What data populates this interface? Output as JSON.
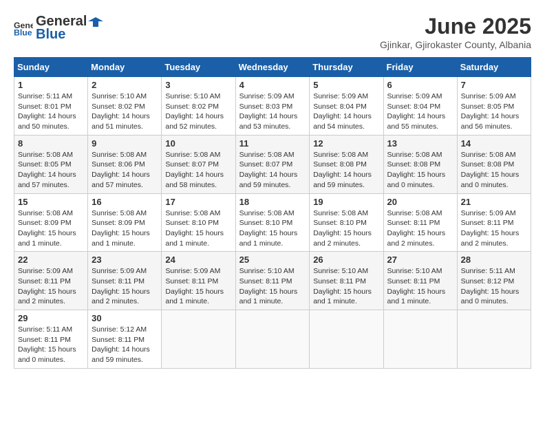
{
  "logo": {
    "general": "General",
    "blue": "Blue"
  },
  "title": "June 2025",
  "location": "Gjinkar, Gjirokaster County, Albania",
  "weekdays": [
    "Sunday",
    "Monday",
    "Tuesday",
    "Wednesday",
    "Thursday",
    "Friday",
    "Saturday"
  ],
  "weeks": [
    [
      {
        "day": "1",
        "sunrise": "Sunrise: 5:11 AM",
        "sunset": "Sunset: 8:01 PM",
        "daylight": "Daylight: 14 hours and 50 minutes."
      },
      {
        "day": "2",
        "sunrise": "Sunrise: 5:10 AM",
        "sunset": "Sunset: 8:02 PM",
        "daylight": "Daylight: 14 hours and 51 minutes."
      },
      {
        "day": "3",
        "sunrise": "Sunrise: 5:10 AM",
        "sunset": "Sunset: 8:02 PM",
        "daylight": "Daylight: 14 hours and 52 minutes."
      },
      {
        "day": "4",
        "sunrise": "Sunrise: 5:09 AM",
        "sunset": "Sunset: 8:03 PM",
        "daylight": "Daylight: 14 hours and 53 minutes."
      },
      {
        "day": "5",
        "sunrise": "Sunrise: 5:09 AM",
        "sunset": "Sunset: 8:04 PM",
        "daylight": "Daylight: 14 hours and 54 minutes."
      },
      {
        "day": "6",
        "sunrise": "Sunrise: 5:09 AM",
        "sunset": "Sunset: 8:04 PM",
        "daylight": "Daylight: 14 hours and 55 minutes."
      },
      {
        "day": "7",
        "sunrise": "Sunrise: 5:09 AM",
        "sunset": "Sunset: 8:05 PM",
        "daylight": "Daylight: 14 hours and 56 minutes."
      }
    ],
    [
      {
        "day": "8",
        "sunrise": "Sunrise: 5:08 AM",
        "sunset": "Sunset: 8:05 PM",
        "daylight": "Daylight: 14 hours and 57 minutes."
      },
      {
        "day": "9",
        "sunrise": "Sunrise: 5:08 AM",
        "sunset": "Sunset: 8:06 PM",
        "daylight": "Daylight: 14 hours and 57 minutes."
      },
      {
        "day": "10",
        "sunrise": "Sunrise: 5:08 AM",
        "sunset": "Sunset: 8:07 PM",
        "daylight": "Daylight: 14 hours and 58 minutes."
      },
      {
        "day": "11",
        "sunrise": "Sunrise: 5:08 AM",
        "sunset": "Sunset: 8:07 PM",
        "daylight": "Daylight: 14 hours and 59 minutes."
      },
      {
        "day": "12",
        "sunrise": "Sunrise: 5:08 AM",
        "sunset": "Sunset: 8:08 PM",
        "daylight": "Daylight: 14 hours and 59 minutes."
      },
      {
        "day": "13",
        "sunrise": "Sunrise: 5:08 AM",
        "sunset": "Sunset: 8:08 PM",
        "daylight": "Daylight: 15 hours and 0 minutes."
      },
      {
        "day": "14",
        "sunrise": "Sunrise: 5:08 AM",
        "sunset": "Sunset: 8:08 PM",
        "daylight": "Daylight: 15 hours and 0 minutes."
      }
    ],
    [
      {
        "day": "15",
        "sunrise": "Sunrise: 5:08 AM",
        "sunset": "Sunset: 8:09 PM",
        "daylight": "Daylight: 15 hours and 1 minute."
      },
      {
        "day": "16",
        "sunrise": "Sunrise: 5:08 AM",
        "sunset": "Sunset: 8:09 PM",
        "daylight": "Daylight: 15 hours and 1 minute."
      },
      {
        "day": "17",
        "sunrise": "Sunrise: 5:08 AM",
        "sunset": "Sunset: 8:10 PM",
        "daylight": "Daylight: 15 hours and 1 minute."
      },
      {
        "day": "18",
        "sunrise": "Sunrise: 5:08 AM",
        "sunset": "Sunset: 8:10 PM",
        "daylight": "Daylight: 15 hours and 1 minute."
      },
      {
        "day": "19",
        "sunrise": "Sunrise: 5:08 AM",
        "sunset": "Sunset: 8:10 PM",
        "daylight": "Daylight: 15 hours and 2 minutes."
      },
      {
        "day": "20",
        "sunrise": "Sunrise: 5:08 AM",
        "sunset": "Sunset: 8:11 PM",
        "daylight": "Daylight: 15 hours and 2 minutes."
      },
      {
        "day": "21",
        "sunrise": "Sunrise: 5:09 AM",
        "sunset": "Sunset: 8:11 PM",
        "daylight": "Daylight: 15 hours and 2 minutes."
      }
    ],
    [
      {
        "day": "22",
        "sunrise": "Sunrise: 5:09 AM",
        "sunset": "Sunset: 8:11 PM",
        "daylight": "Daylight: 15 hours and 2 minutes."
      },
      {
        "day": "23",
        "sunrise": "Sunrise: 5:09 AM",
        "sunset": "Sunset: 8:11 PM",
        "daylight": "Daylight: 15 hours and 2 minutes."
      },
      {
        "day": "24",
        "sunrise": "Sunrise: 5:09 AM",
        "sunset": "Sunset: 8:11 PM",
        "daylight": "Daylight: 15 hours and 1 minute."
      },
      {
        "day": "25",
        "sunrise": "Sunrise: 5:10 AM",
        "sunset": "Sunset: 8:11 PM",
        "daylight": "Daylight: 15 hours and 1 minute."
      },
      {
        "day": "26",
        "sunrise": "Sunrise: 5:10 AM",
        "sunset": "Sunset: 8:11 PM",
        "daylight": "Daylight: 15 hours and 1 minute."
      },
      {
        "day": "27",
        "sunrise": "Sunrise: 5:10 AM",
        "sunset": "Sunset: 8:11 PM",
        "daylight": "Daylight: 15 hours and 1 minute."
      },
      {
        "day": "28",
        "sunrise": "Sunrise: 5:11 AM",
        "sunset": "Sunset: 8:12 PM",
        "daylight": "Daylight: 15 hours and 0 minutes."
      }
    ],
    [
      {
        "day": "29",
        "sunrise": "Sunrise: 5:11 AM",
        "sunset": "Sunset: 8:11 PM",
        "daylight": "Daylight: 15 hours and 0 minutes."
      },
      {
        "day": "30",
        "sunrise": "Sunrise: 5:12 AM",
        "sunset": "Sunset: 8:11 PM",
        "daylight": "Daylight: 14 hours and 59 minutes."
      },
      null,
      null,
      null,
      null,
      null
    ]
  ]
}
